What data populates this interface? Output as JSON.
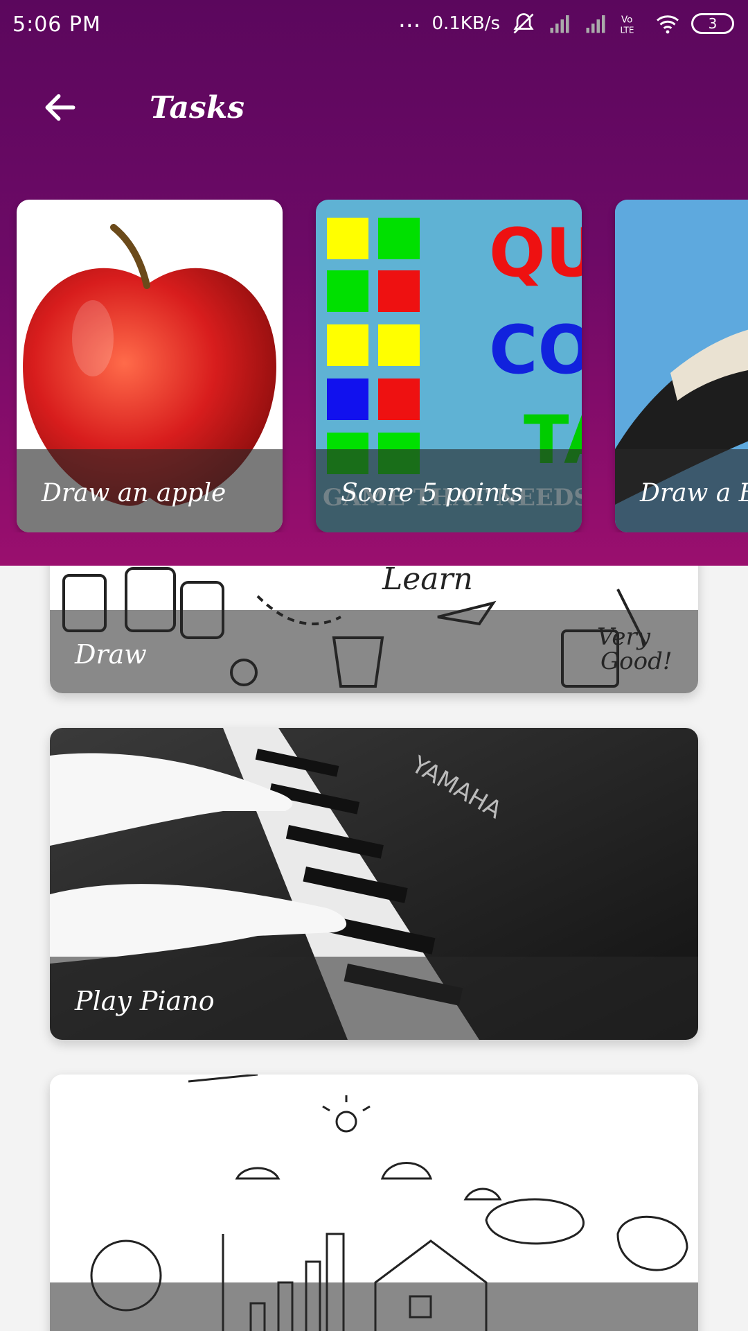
{
  "status_bar": {
    "time": "5:06 PM",
    "dots": "...",
    "network_speed": "0.1KB/s",
    "battery": "3",
    "icons": [
      "mute-bell-icon",
      "signal-icon",
      "signal-icon",
      "volte-icon",
      "wifi-icon",
      "battery-icon"
    ]
  },
  "app_bar": {
    "title": "Tasks",
    "back_icon": "arrow-left-icon"
  },
  "featured": [
    {
      "label": "Draw an apple",
      "image": "apple"
    },
    {
      "label": "Score 5 points",
      "image": "color-game",
      "overlay_text": "GAME THAT NEEDS QU"
    },
    {
      "label": "Draw a B",
      "image": "bird"
    }
  ],
  "list": [
    {
      "label": "Draw",
      "image": "doodles"
    },
    {
      "label": "Play Piano",
      "image": "piano"
    },
    {
      "label": "",
      "image": "city-doodle"
    }
  ],
  "colors": {
    "primary": "#5b075d",
    "accent": "#9a0f6e",
    "background": "#f3f3f3"
  }
}
